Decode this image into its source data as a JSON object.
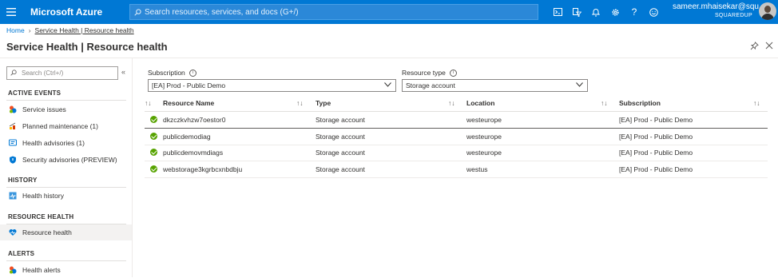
{
  "topbar": {
    "menu_icon": "hamburger-icon",
    "brand": "Microsoft Azure",
    "search_placeholder": "Search resources, services, and docs (G+/)",
    "icons": [
      "cloud-shell-icon",
      "directory-filter-icon",
      "notifications-icon",
      "settings-icon",
      "help-icon",
      "feedback-icon"
    ],
    "account_name": "sameer.mhaisekar@squ...",
    "account_tenant": "SQUAREDUP",
    "color": "#0078d4"
  },
  "breadcrumb": {
    "home": "Home",
    "current": "Service Health | Resource health"
  },
  "page": {
    "title": "Service Health | Resource health"
  },
  "sidebar": {
    "search_placeholder": "Search (Ctrl+/)",
    "sections": [
      {
        "title": "ACTIVE EVENTS",
        "items": [
          {
            "label": "Service issues",
            "icon": "service-issues-icon"
          },
          {
            "label": "Planned maintenance (1)",
            "icon": "planned-maintenance-icon"
          },
          {
            "label": "Health advisories (1)",
            "icon": "health-advisories-icon"
          },
          {
            "label": "Security advisories (PREVIEW)",
            "icon": "security-advisories-icon"
          }
        ]
      },
      {
        "title": "HISTORY",
        "items": [
          {
            "label": "Health history",
            "icon": "health-history-icon"
          }
        ]
      },
      {
        "title": "RESOURCE HEALTH",
        "items": [
          {
            "label": "Resource health",
            "icon": "resource-health-icon",
            "active": true
          }
        ]
      },
      {
        "title": "ALERTS",
        "items": [
          {
            "label": "Health alerts",
            "icon": "health-alerts-icon"
          }
        ]
      }
    ]
  },
  "filters": {
    "subscription": {
      "label": "Subscription",
      "value": "[EA] Prod - Public Demo"
    },
    "resource_type": {
      "label": "Resource type",
      "value": "Storage account"
    }
  },
  "table": {
    "columns": [
      "Resource Name",
      "Type",
      "Location",
      "Subscription"
    ],
    "rows": [
      {
        "name": "dkzczkvhzw7oestor0",
        "type": "Storage account",
        "location": "westeurope",
        "subscription": "[EA] Prod - Public Demo",
        "status": "available"
      },
      {
        "name": "publicdemodiag",
        "type": "Storage account",
        "location": "westeurope",
        "subscription": "[EA] Prod - Public Demo",
        "status": "available"
      },
      {
        "name": "publicdemovmdiags",
        "type": "Storage account",
        "location": "westeurope",
        "subscription": "[EA] Prod - Public Demo",
        "status": "available"
      },
      {
        "name": "webstorage3kgrbcxnbdbju",
        "type": "Storage account",
        "location": "westus",
        "subscription": "[EA] Prod - Public Demo",
        "status": "available"
      }
    ]
  }
}
